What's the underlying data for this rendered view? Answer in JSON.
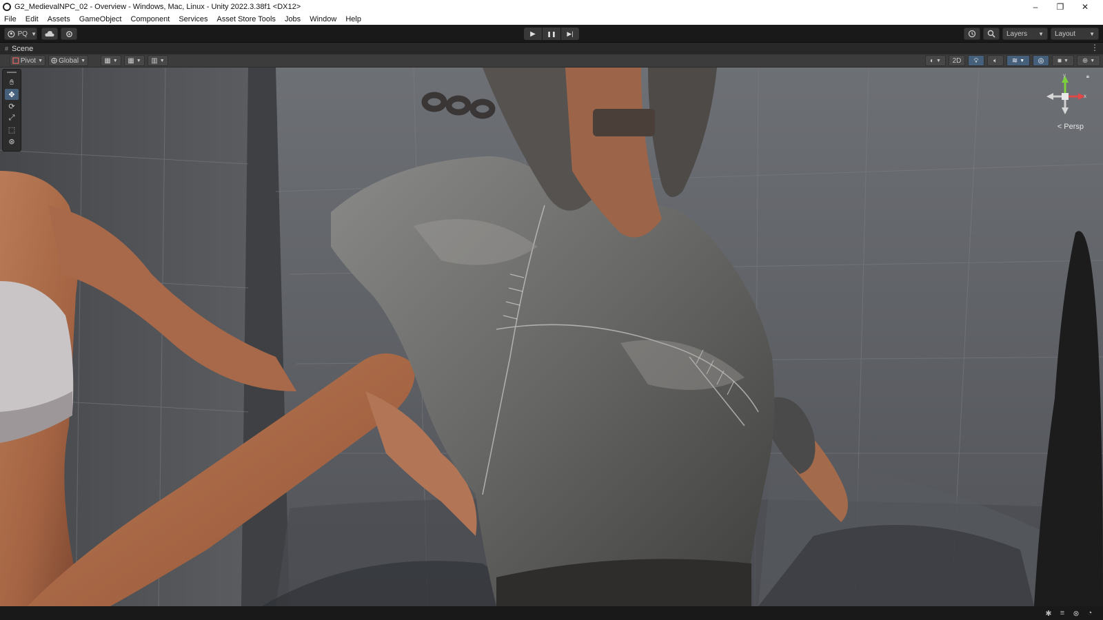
{
  "window": {
    "title": "G2_MedievalNPC_02 - Overview - Windows, Mac, Linux - Unity 2022.3.38f1 <DX12>",
    "minimize_glyph": "–",
    "restore_glyph": "❐",
    "close_glyph": "✕"
  },
  "menu": [
    "File",
    "Edit",
    "Assets",
    "GameObject",
    "Component",
    "Services",
    "Asset Store Tools",
    "Jobs",
    "Window",
    "Help"
  ],
  "toolbar": {
    "account_label": "PQ",
    "play_glyph": "▶",
    "pause_glyph": "❚❚",
    "step_glyph": "▶|",
    "layers_label": "Layers",
    "layout_label": "Layout"
  },
  "scene_tab": {
    "label": "Scene"
  },
  "scene_toolbar": {
    "pivot_label": "Pivot",
    "global_label": "Global",
    "mode_2d_label": "2D"
  },
  "viewport": {
    "camera_label": "Persp",
    "gizmo_axes": {
      "x": "x",
      "y": "y"
    }
  },
  "icons": {
    "colors": {
      "accent": "#46607c",
      "axis_x": "#e04848",
      "axis_y": "#7cd23c",
      "axis_z": "#4a7ee0"
    }
  }
}
